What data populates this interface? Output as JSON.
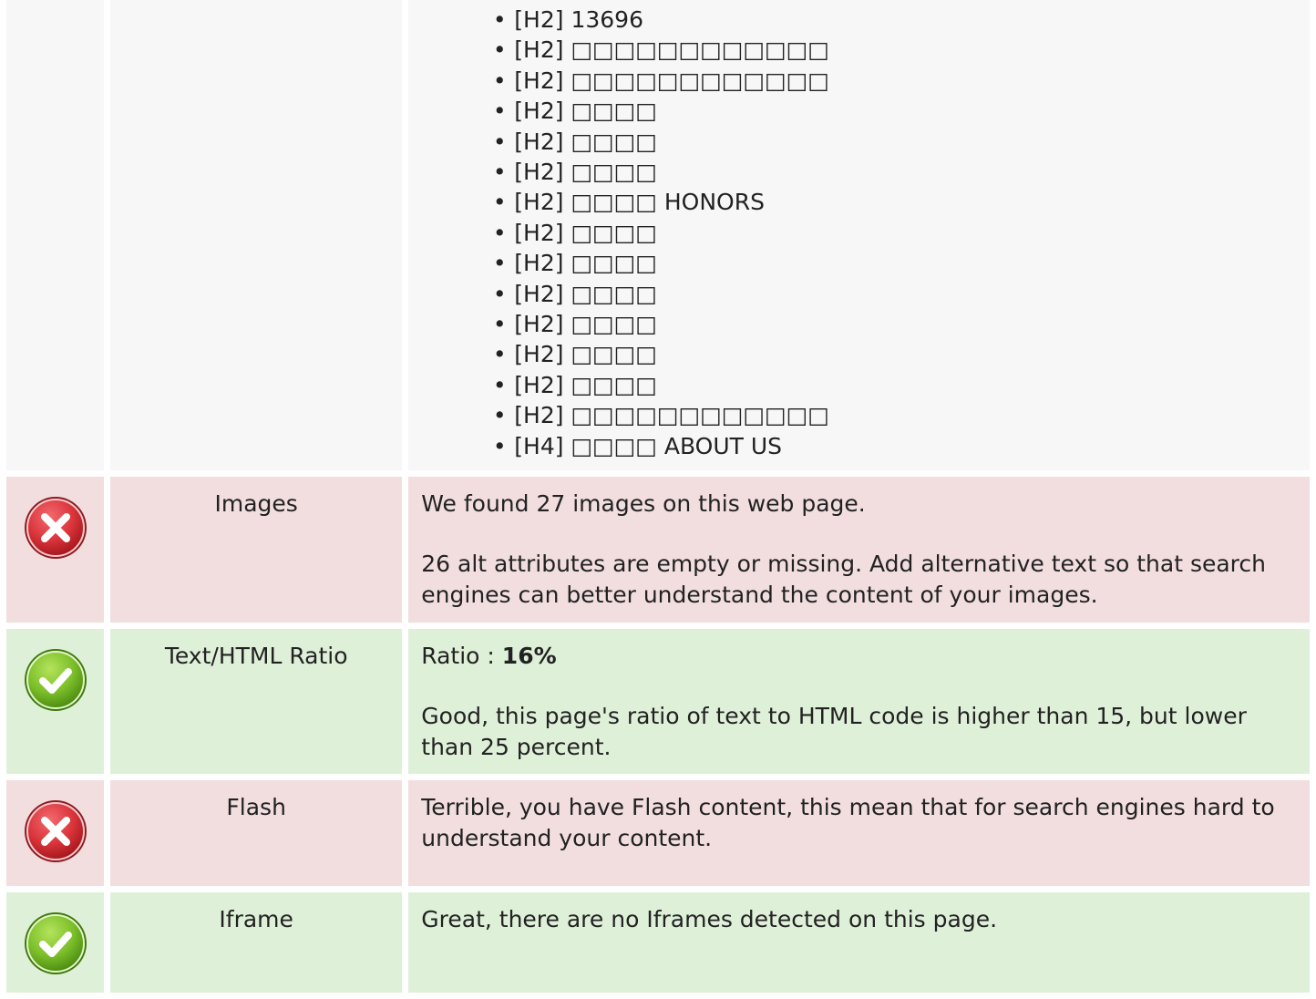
{
  "headings": {
    "items": [
      {
        "bullet": "•",
        "text": "[H2] 13696"
      },
      {
        "bullet": "•",
        "text": "[H2] □□□□□□□□□□□□"
      },
      {
        "bullet": "•",
        "text": "[H2] □□□□□□□□□□□□"
      },
      {
        "bullet": "•",
        "text": "[H2] □□□□"
      },
      {
        "bullet": "•",
        "text": "[H2] □□□□"
      },
      {
        "bullet": "•",
        "text": "[H2] □□□□"
      },
      {
        "bullet": "•",
        "text": "[H2] □□□□ HONORS"
      },
      {
        "bullet": "•",
        "text": "[H2] □□□□"
      },
      {
        "bullet": "•",
        "text": "[H2] □□□□"
      },
      {
        "bullet": "•",
        "text": "[H2] □□□□"
      },
      {
        "bullet": "•",
        "text": "[H2] □□□□"
      },
      {
        "bullet": "•",
        "text": "[H2] □□□□"
      },
      {
        "bullet": "•",
        "text": "[H2] □□□□"
      },
      {
        "bullet": "•",
        "text": "[H2] □□□□□□□□□□□□"
      },
      {
        "bullet": "•",
        "text": "[H4] □□□□ ABOUT US"
      }
    ]
  },
  "images": {
    "status": "error",
    "status_icon": "error-x-icon",
    "label": "Images",
    "line1": "We found 27 images on this web page.",
    "line2": "26 alt attributes are empty or missing. Add alternative text so that search engines can better understand the content of your images."
  },
  "ratio": {
    "status": "success",
    "status_icon": "success-check-icon",
    "label": "Text/HTML Ratio",
    "ratio_prefix": "Ratio : ",
    "ratio_value": "16%",
    "line2": "Good, this page's ratio of text to HTML code is higher than 15, but lower than 25 percent."
  },
  "flash": {
    "status": "error",
    "status_icon": "error-x-icon",
    "label": "Flash",
    "line1": "Terrible, you have Flash content, this mean that for search engines hard to understand your content."
  },
  "iframe": {
    "status": "success",
    "status_icon": "success-check-icon",
    "label": "Iframe",
    "line1": "Great, there are no Iframes detected on this page."
  },
  "colors": {
    "neutral_bg": "#f7f7f7",
    "error_bg": "#f2dedf",
    "success_bg": "#dff0d9",
    "error_icon": "#d9343a",
    "success_icon": "#7cbf2a"
  }
}
